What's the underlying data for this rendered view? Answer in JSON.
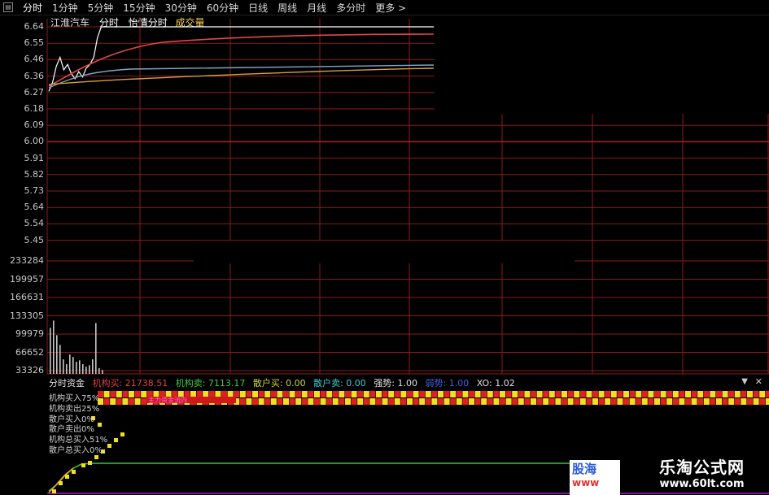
{
  "tabs": [
    {
      "label": "分时",
      "active": true
    },
    {
      "label": "1分钟"
    },
    {
      "label": "5分钟"
    },
    {
      "label": "15分钟"
    },
    {
      "label": "30分钟"
    },
    {
      "label": "60分钟"
    },
    {
      "label": "日线"
    },
    {
      "label": "周线"
    },
    {
      "label": "月线"
    },
    {
      "label": "多分时"
    },
    {
      "label": "更多 >"
    }
  ],
  "menu_icon": "menu-icon",
  "stock": {
    "name": "江淮汽车",
    "mode": "分时",
    "indicator": "怡情分时",
    "volume_label": "成交量"
  },
  "price_axis": [
    "6.64",
    "6.55",
    "6.46",
    "6.36",
    "6.27",
    "6.18",
    "6.09",
    "6.00",
    "5.91",
    "5.82",
    "5.73",
    "5.64",
    "5.54",
    "5.45"
  ],
  "volume_axis": [
    "233284",
    "199957",
    "166631",
    "133305",
    "99979",
    "66652",
    "33326"
  ],
  "indicator_bar": {
    "name": "分时资金",
    "inst_buy": "机构买: 21738.51",
    "inst_sell": "机构卖: 7113.17",
    "retail_buy": "散户买: 0.00",
    "retail_sell": "散户卖: 0.00",
    "strength": "强势: 1.00",
    "weak": "弱势: 1.00",
    "xo": "XO: 1.02"
  },
  "indicator_labels": [
    "机构买入75%",
    "机构卖出25%",
    "散户买入0%",
    "散户卖出0%",
    "机构总买入51%",
    "散户总买入0%"
  ],
  "banner_text": "主力资金流向",
  "colors": {
    "grid": "#8b1a1a",
    "price_line": "#ffffff",
    "avg_red": "#e04848",
    "avg_blue": "#7da8c8",
    "avg_orange": "#d8a040",
    "volume": "#c8c8c8",
    "green": "#33c833",
    "bar_red": "#e02020",
    "bar_yellow": "#f0e020"
  },
  "chart_data": {
    "type": "line",
    "price_ylim": [
      5.45,
      6.64
    ],
    "price_series": {
      "name": "",
      "values": [
        6.28,
        6.33,
        6.42,
        6.47,
        6.4,
        6.43,
        6.38,
        6.35,
        6.39,
        6.36,
        6.41,
        6.43,
        6.47,
        6.58,
        6.64,
        6.64,
        6.64,
        6.64,
        6.64,
        6.64,
        6.64,
        6.64,
        6.64,
        6.64,
        6.64,
        6.64,
        6.64,
        6.64,
        6.64,
        6.64,
        6.64,
        6.64,
        6.64,
        6.64,
        6.64,
        6.64,
        6.64,
        6.64,
        6.64,
        6.64
      ]
    },
    "volume_ylim": [
      0,
      233284
    ],
    "volume": [
      95000,
      110000,
      80000,
      60000,
      30000,
      20000,
      40000,
      35000,
      25000,
      28000,
      20000,
      15000,
      18000,
      30000,
      105000,
      12000,
      8000
    ]
  },
  "watermark": {
    "title": "乐淘公式网",
    "url": "www.60lt.com"
  },
  "logo2": {
    "line1": "股海",
    "line2": "www"
  }
}
